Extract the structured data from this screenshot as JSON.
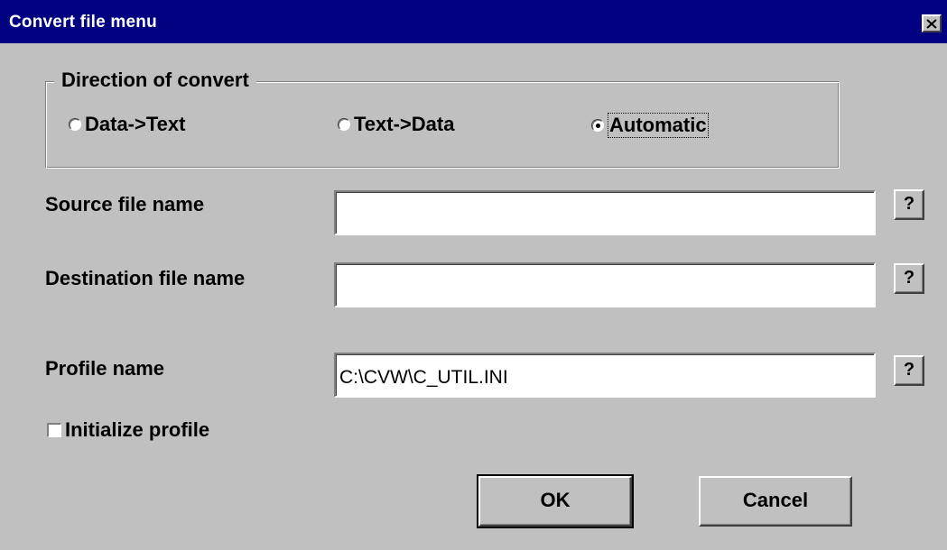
{
  "window": {
    "title": "Convert file menu",
    "close_glyph": "close-icon"
  },
  "direction": {
    "legend": "Direction of convert",
    "options": [
      {
        "label": "Data->Text",
        "selected": false
      },
      {
        "label": "Text->Data",
        "selected": false
      },
      {
        "label": "Automatic",
        "selected": true
      }
    ]
  },
  "source": {
    "label": "Source file name",
    "value": "",
    "browse_label": "?"
  },
  "destination": {
    "label": "Destination file name",
    "value": "",
    "browse_label": "?"
  },
  "profile": {
    "label": "Profile name",
    "value": "C:\\CVW\\C_UTIL.INI",
    "browse_label": "?"
  },
  "init_profile": {
    "label": "Initialize profile",
    "checked": false
  },
  "buttons": {
    "ok": "OK",
    "cancel": "Cancel"
  },
  "colors": {
    "title_bar": "#000080",
    "dialog_bg": "#c0c0c0"
  }
}
